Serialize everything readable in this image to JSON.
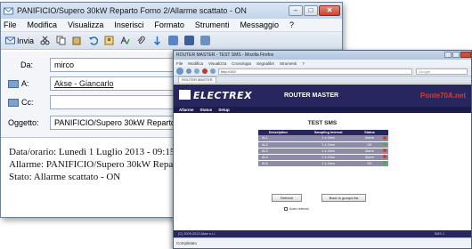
{
  "email": {
    "title": "PANIFICIO/Supero 30kW Reparto Forno 2/Allarme scattato - ON",
    "window_controls": [
      "–",
      "□",
      "✕"
    ],
    "menu": [
      "File",
      "Modifica",
      "Visualizza",
      "Inserisci",
      "Formato",
      "Strumenti",
      "Messaggio",
      "?"
    ],
    "toolbar": {
      "send_label": "Invia"
    },
    "fields": {
      "from_label": "Da:",
      "from_value": "mirco",
      "to_label": "A:",
      "to_value": "Akse - Giancarlo",
      "cc_label": "Cc:",
      "cc_value": "",
      "subject_label": "Oggetto:",
      "subject_value": "PANIFICIO/Supero 30kW Reparto Forno 2/Allarme scattato - ON"
    },
    "body": [
      "Data/orario: Lunedì    1 Luglio 2013 - 09:15",
      "Allarme: PANIFICIO/Supero 30kW Reparto Forno 2",
      "Stato: Allarme scattato - ON"
    ]
  },
  "browser": {
    "title": "ROUTER MASTER - TEST SMS - Mozilla Firefox",
    "menu": [
      "File",
      "Modifica",
      "Visualizza",
      "Cronologia",
      "Segnalibri",
      "Strumenti",
      "?"
    ],
    "address": "http://192.",
    "search_placeholder": "Google",
    "tab_label": "ROUTER MASTER",
    "status_bar": "Completato"
  },
  "site": {
    "logo": "ELECTREX",
    "header_title": "ROUTER MASTER",
    "header_right": "Ponte70A.net",
    "nav": [
      "Allarme",
      "Status",
      "Setup"
    ],
    "page_title": "TEST SMS",
    "columns": [
      "Description",
      "Sampling Interval",
      "Status"
    ],
    "rows": [
      {
        "desc": "AL1",
        "interval": "1 s  2min",
        "status": "Alarm",
        "dot": "#d83a2a"
      },
      {
        "desc": "AL2",
        "interval": "1 s  2min",
        "status": "OK",
        "dot": "#3fb43f"
      },
      {
        "desc": "AL3",
        "interval": "1 s  2min",
        "status": "Alarm",
        "dot": "#d83a2a"
      },
      {
        "desc": "AL4",
        "interval": "1 s  2min",
        "status": "Alarm",
        "dot": "#d83a2a"
      },
      {
        "desc": "AL5",
        "interval": "1 s  2min",
        "status": "OK",
        "dot": "#3fb43f"
      }
    ],
    "btn_refresh": "Refresh",
    "btn_back": "Back to groups list",
    "auto_refresh": "Auto refresh",
    "footer_left": "(C) 2009-2013 Akse s.r.l.",
    "footer_right": "SMS 1"
  },
  "colors": {
    "brand": "#27265e",
    "alarm": "#d83a2a",
    "ok": "#3fb43f"
  }
}
